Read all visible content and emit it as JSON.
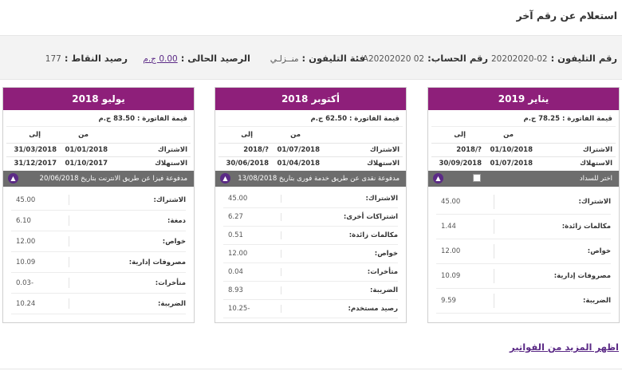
{
  "page_title": "استعلام عن رقم آخر",
  "info": {
    "phone_label": "رقم التليفون :",
    "phone_value": "02-20202020",
    "account_label": "رقم الحساب:",
    "account_value": "A20202020 02",
    "category_label": "فئة التليفون :",
    "category_value": "منــزلـي",
    "balance_label": "الرصيد الحالى :",
    "balance_value": "0.00 ج.م",
    "points_label": "رصيد النقاط :",
    "points_value": "177"
  },
  "common": {
    "from": "من",
    "to": "إلى",
    "subscription": "الاشتراك",
    "consumption": "الاستهلاك"
  },
  "cards": [
    {
      "month": "يناير 2019",
      "amount": "قيمة الفاتورة : 78.25 ج.م",
      "sub_from": "01/10/2018",
      "sub_to": "?/2018",
      "con_from": "01/07/2018",
      "con_to": "30/09/2018",
      "status": "اختر للسداد",
      "items": [
        {
          "label": "الاشتراك:",
          "value": "45.00"
        },
        {
          "label": "مكالمات زائدة:",
          "value": "1.44"
        },
        {
          "label": "خواص:",
          "value": "12.00"
        },
        {
          "label": "مصروفات إدارية:",
          "value": "10.09"
        },
        {
          "label": "الضريبة:",
          "value": "9.59"
        }
      ]
    },
    {
      "month": "أكتوبر 2018",
      "amount": "قيمة الفاتورة : 62.50 ج.م",
      "sub_from": "01/07/2018",
      "sub_to": "?/2018",
      "con_from": "01/04/2018",
      "con_to": "30/06/2018",
      "status": "مدفوعة نقدى عن طريق خدمة فورى بتاريخ 13/08/2018",
      "items": [
        {
          "label": "الاشتراك:",
          "value": "45.00"
        },
        {
          "label": "اشتراكات أخرى:",
          "value": "6.27"
        },
        {
          "label": "مكالمات زائدة:",
          "value": "0.51"
        },
        {
          "label": "خواص:",
          "value": "12.00"
        },
        {
          "label": "متأخرات:",
          "value": "0.04"
        },
        {
          "label": "الضريبة:",
          "value": "8.93"
        },
        {
          "label": "رصيد مستخدم:",
          "value": "-10.25"
        }
      ]
    },
    {
      "month": "يوليو 2018",
      "amount": "قيمة الفاتورة : 83.50 ج.م",
      "sub_from": "01/01/2018",
      "sub_to": "31/03/2018",
      "con_from": "01/10/2017",
      "con_to": "31/12/2017",
      "status": "مدفوعة فيزا عن طريق الانترنت بتاريخ 20/06/2018",
      "items": [
        {
          "label": "الاشتراك:",
          "value": "45.00"
        },
        {
          "label": "دمغة:",
          "value": "6.10"
        },
        {
          "label": "خواص:",
          "value": "12.00"
        },
        {
          "label": "مصروفات إدارية:",
          "value": "10.09"
        },
        {
          "label": "متأخرات:",
          "value": "-0.03"
        },
        {
          "label": "الضريبة:",
          "value": "10.24"
        }
      ]
    }
  ],
  "more_link": "اظهر المزيد من الفواتير",
  "colors": {
    "header": "#8e1f7a",
    "accent": "#5b2a86",
    "status_bar": "#6d6d6d"
  },
  "icons": {
    "chevron": "chevron-up-icon",
    "checkbox": "checkbox-icon"
  }
}
